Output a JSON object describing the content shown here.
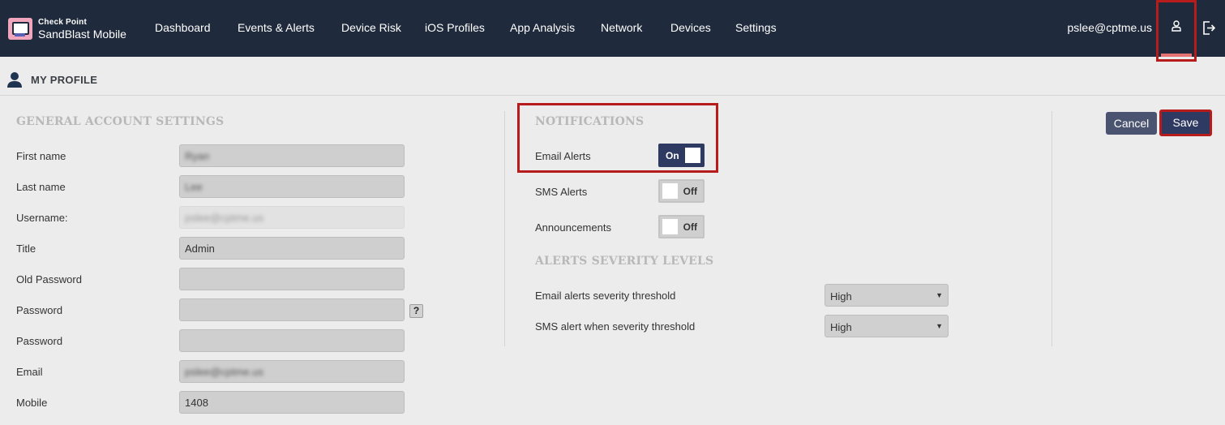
{
  "app": {
    "brand_line1": "Check Point",
    "brand_line2": "SandBlast Mobile"
  },
  "nav": {
    "items": [
      {
        "label": "Dashboard"
      },
      {
        "label": "Events & Alerts"
      },
      {
        "label": "Device Risk"
      },
      {
        "label": "iOS Profiles"
      },
      {
        "label": "App Analysis"
      },
      {
        "label": "Network"
      },
      {
        "label": "Devices"
      },
      {
        "label": "Settings"
      }
    ],
    "user_email": "pslee@cptme.us",
    "user_icon": "user-icon",
    "logout_icon": "logout-icon"
  },
  "page": {
    "title": "MY PROFILE"
  },
  "account": {
    "section_title": "GENERAL ACCOUNT SETTINGS",
    "fields": [
      {
        "label": "First name",
        "value": "Ryan"
      },
      {
        "label": "Last name",
        "value": "Lee"
      },
      {
        "label": "Username:",
        "value": "pslee@cptme.us"
      },
      {
        "label": "Title",
        "value": "Admin"
      },
      {
        "label": "Old Password",
        "value": ""
      },
      {
        "label": "Password",
        "value": ""
      },
      {
        "label": "Password",
        "value": ""
      },
      {
        "label": "Email",
        "value": "pslee@cptme.us"
      },
      {
        "label": "Mobile",
        "value": "1408"
      }
    ],
    "help_symbol": "?"
  },
  "notifications": {
    "section_title": "NOTIFICATIONS",
    "items": [
      {
        "label": "Email Alerts",
        "state": "On"
      },
      {
        "label": "SMS Alerts",
        "state": "Off"
      },
      {
        "label": "Announcements",
        "state": "Off"
      }
    ]
  },
  "severity": {
    "section_title": "ALERTS SEVERITY LEVELS",
    "items": [
      {
        "label": "Email alerts severity threshold",
        "value": "High"
      },
      {
        "label": "SMS alert when severity threshold",
        "value": "High"
      }
    ]
  },
  "actions": {
    "cancel_label": "Cancel",
    "save_label": "Save"
  },
  "colors": {
    "topbar": "#1f2a3c",
    "accent": "#2f3a63",
    "highlight": "#b71c1c"
  }
}
